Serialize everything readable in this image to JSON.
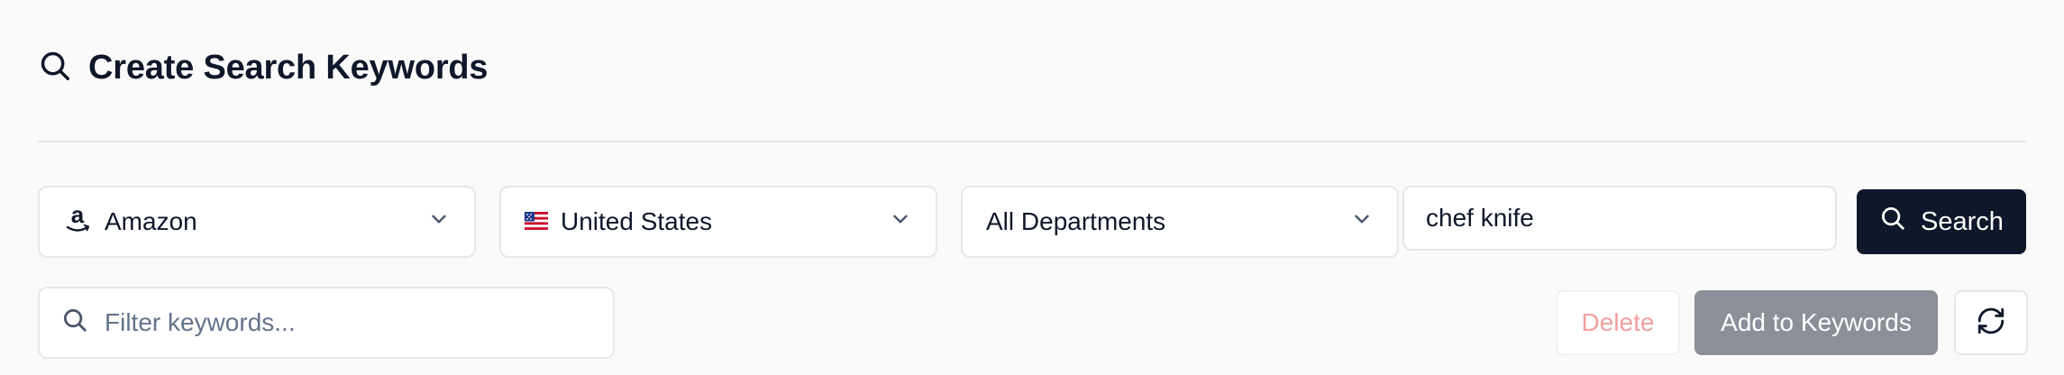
{
  "header": {
    "title": "Create Search Keywords",
    "icon": "search-icon"
  },
  "filters": {
    "marketplace": {
      "value": "Amazon",
      "icon": "amazon-logo-icon"
    },
    "country": {
      "value": "United States",
      "icon": "us-flag-icon"
    },
    "department": {
      "value": "All Departments"
    }
  },
  "search": {
    "query": "chef knife",
    "button_label": "Search"
  },
  "keyword_filter": {
    "placeholder": "Filter keywords..."
  },
  "actions": {
    "delete_label": "Delete",
    "add_label": "Add to Keywords",
    "refresh_icon": "refresh-icon"
  },
  "colors": {
    "primary": "#0f172a",
    "border": "#e5e7eb",
    "danger_disabled": "#f0a0a0",
    "add_disabled": "#8b8f98"
  }
}
